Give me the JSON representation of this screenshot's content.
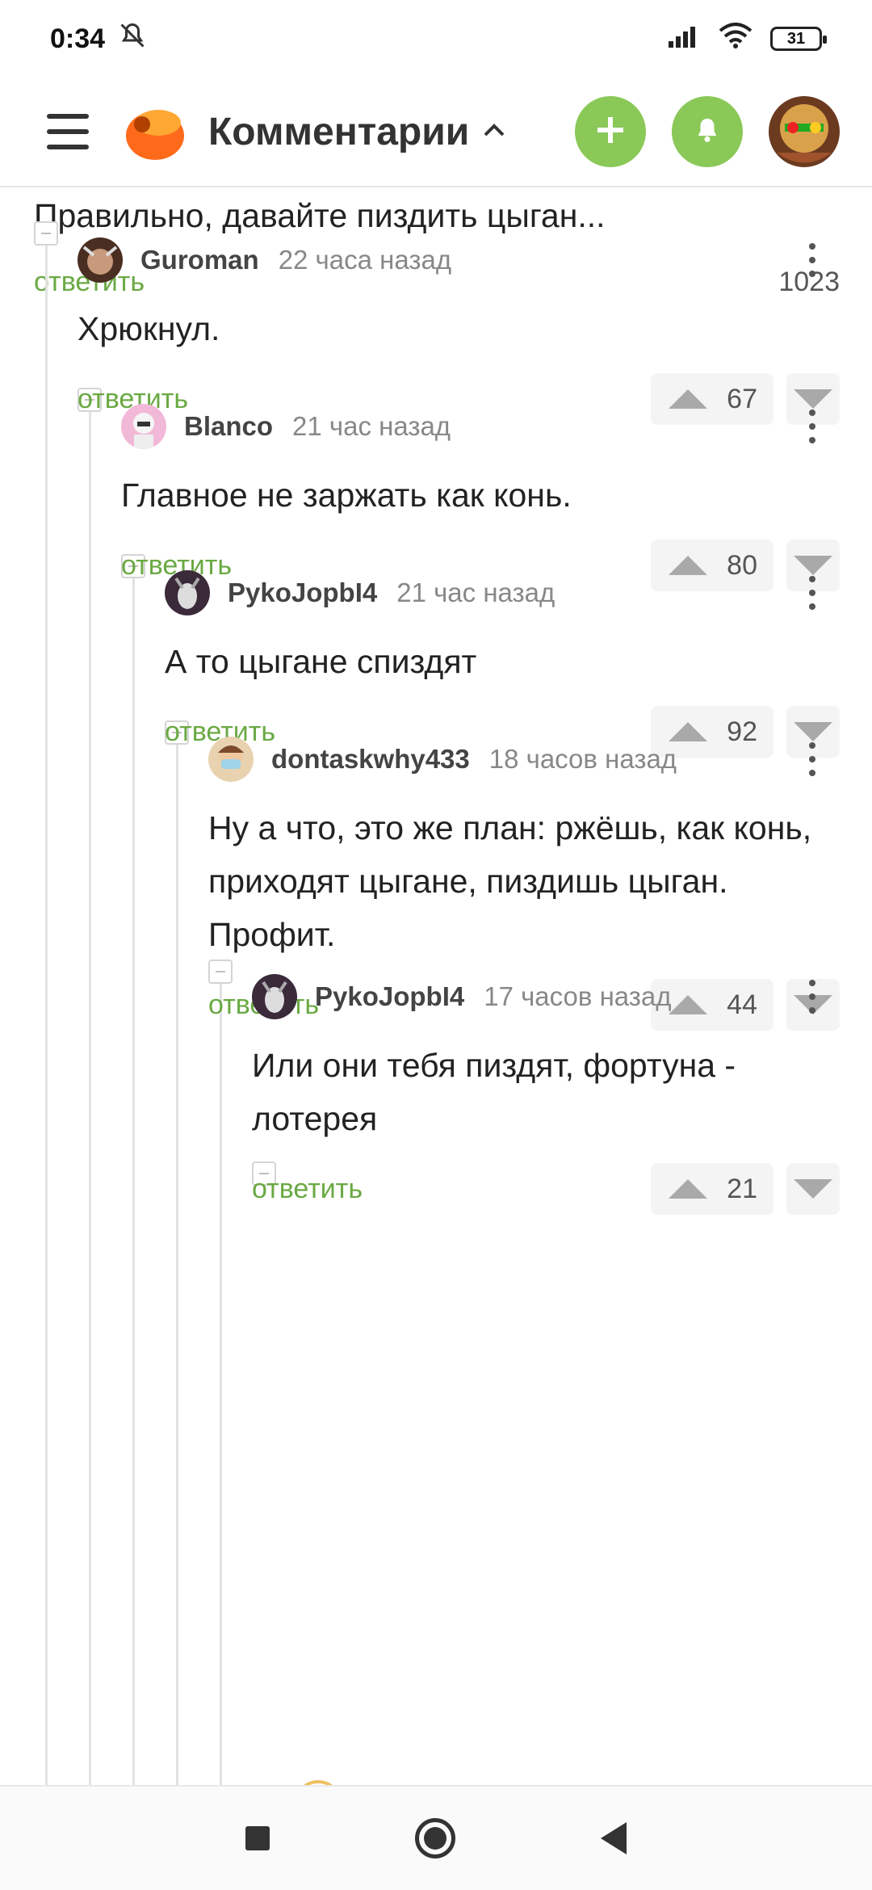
{
  "status_bar": {
    "time": "0:34",
    "battery": "31"
  },
  "app_bar": {
    "title": "Комментарии"
  },
  "previous_comment": {
    "text": "Правильно, давайте пиздить цыган...",
    "reply_label": "ответить",
    "score": "1023"
  },
  "comments": [
    {
      "author": "Guroman",
      "time": "22 часа назад",
      "text": "Хрюкнул.",
      "reply_label": "ответить",
      "score": "67"
    },
    {
      "author": "Blanco",
      "time": "21 час назад",
      "text": "Главное не заржать как конь.",
      "reply_label": "ответить",
      "score": "80"
    },
    {
      "author": "PykoJopbI4",
      "time": "21 час назад",
      "text": "А то цыгане спиздят",
      "reply_label": "ответить",
      "score": "92"
    },
    {
      "author": "dontaskwhy433",
      "time": "18 часов назад",
      "text": "Ну а что, это же план: ржёшь, как конь, приходят цыгане, пиздишь цыган. Профит.",
      "reply_label": "ответить",
      "score": "44"
    },
    {
      "author": "PykoJopbI4",
      "time": "17 часов назад",
      "text": "Или они тебя пиздят, фортуна - лотерея",
      "reply_label": "ответить",
      "score": "21"
    }
  ],
  "colors": {
    "accent_green": "#8ac858",
    "reply_green": "#6aa943"
  },
  "icons": [
    "menu-icon",
    "app-logo-icon",
    "caret-up-icon",
    "plus-icon",
    "bell-icon",
    "more-vert-icon",
    "vote-up-icon",
    "vote-down-icon"
  ]
}
